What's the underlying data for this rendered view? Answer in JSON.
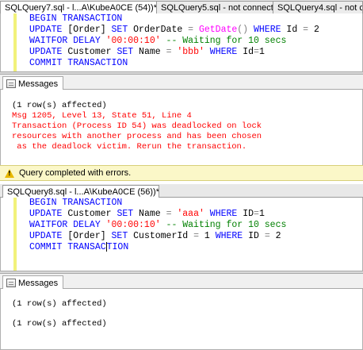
{
  "tabs_top": [
    {
      "label": "SQLQuery7.sql - l...A\\KubeA0CE (54))*",
      "active": true
    },
    {
      "label": "SQLQuery5.sql - not connected",
      "active": false
    },
    {
      "label": "SQLQuery4.sql - not conne",
      "active": false
    }
  ],
  "editor1": {
    "lines": [
      [
        {
          "t": "BEGIN TRANSACTION",
          "c": "kw"
        }
      ],
      [
        {
          "t": "UPDATE ",
          "c": "kw"
        },
        {
          "t": "[Order] ",
          "c": "plain"
        },
        {
          "t": "SET ",
          "c": "kw"
        },
        {
          "t": "OrderDate ",
          "c": "plain"
        },
        {
          "t": "= ",
          "c": "gr"
        },
        {
          "t": "GetDate",
          "c": "fn"
        },
        {
          "t": "() ",
          "c": "gr"
        },
        {
          "t": "WHERE ",
          "c": "kw"
        },
        {
          "t": "Id ",
          "c": "plain"
        },
        {
          "t": "= ",
          "c": "gr"
        },
        {
          "t": "2",
          "c": "plain"
        }
      ],
      [
        {
          "t": "WAITFOR DELAY ",
          "c": "kw"
        },
        {
          "t": "'00:00:10' ",
          "c": "str"
        },
        {
          "t": "-- Waiting for 10 secs",
          "c": "cm"
        }
      ],
      [
        {
          "t": "UPDATE ",
          "c": "kw"
        },
        {
          "t": "Customer ",
          "c": "plain"
        },
        {
          "t": "SET ",
          "c": "kw"
        },
        {
          "t": "Name ",
          "c": "plain"
        },
        {
          "t": "= ",
          "c": "gr"
        },
        {
          "t": "'bbb' ",
          "c": "str"
        },
        {
          "t": "WHERE ",
          "c": "kw"
        },
        {
          "t": "Id",
          "c": "plain"
        },
        {
          "t": "=",
          "c": "gr"
        },
        {
          "t": "1",
          "c": "plain"
        }
      ],
      [
        {
          "t": "COMMIT TRANSACTION",
          "c": "kw"
        }
      ]
    ]
  },
  "messages1": {
    "tab_label": "Messages",
    "lines": [
      {
        "text": "(1 row(s) affected)",
        "kind": "normal"
      },
      {
        "text": "Msg 1205, Level 13, State 51, Line 4",
        "kind": "error"
      },
      {
        "text": "Transaction (Process ID 54) was deadlocked on lock",
        "kind": "error"
      },
      {
        "text": "resources with another process and has been chosen",
        "kind": "error"
      },
      {
        "text": " as the deadlock victim. Rerun the transaction.",
        "kind": "error"
      }
    ]
  },
  "status1": {
    "text": "Query completed with errors."
  },
  "tab_second": {
    "label": "SQLQuery8.sql - l...A\\KubeA0CE (56))*"
  },
  "editor2": {
    "lines": [
      [
        {
          "t": "BEGIN TRANSACTION",
          "c": "kw"
        }
      ],
      [
        {
          "t": "UPDATE ",
          "c": "kw"
        },
        {
          "t": "Customer ",
          "c": "plain"
        },
        {
          "t": "SET ",
          "c": "kw"
        },
        {
          "t": "Name ",
          "c": "plain"
        },
        {
          "t": "= ",
          "c": "gr"
        },
        {
          "t": "'aaa' ",
          "c": "str"
        },
        {
          "t": "WHERE ",
          "c": "kw"
        },
        {
          "t": "ID",
          "c": "plain"
        },
        {
          "t": "=",
          "c": "gr"
        },
        {
          "t": "1",
          "c": "plain"
        }
      ],
      [
        {
          "t": "WAITFOR DELAY ",
          "c": "kw"
        },
        {
          "t": "'00:00:10' ",
          "c": "str"
        },
        {
          "t": "-- Waiting for 10 secs",
          "c": "cm"
        }
      ],
      [
        {
          "t": "UPDATE ",
          "c": "kw"
        },
        {
          "t": "[Order] ",
          "c": "plain"
        },
        {
          "t": "SET ",
          "c": "kw"
        },
        {
          "t": "CustomerId ",
          "c": "plain"
        },
        {
          "t": "= ",
          "c": "gr"
        },
        {
          "t": "1 ",
          "c": "plain"
        },
        {
          "t": "WHERE ",
          "c": "kw"
        },
        {
          "t": "ID ",
          "c": "plain"
        },
        {
          "t": "= ",
          "c": "gr"
        },
        {
          "t": "2",
          "c": "plain"
        }
      ],
      [
        {
          "t": "COMMIT TRANSAC",
          "c": "kw"
        },
        {
          "t": "|",
          "c": "cursor"
        },
        {
          "t": "TION",
          "c": "kw"
        }
      ]
    ]
  },
  "messages2": {
    "tab_label": "Messages",
    "lines": [
      {
        "text": "(1 row(s) affected)",
        "kind": "normal"
      },
      {
        "text": "(1 row(s) affected)",
        "kind": "normal"
      }
    ]
  },
  "colors": {
    "keyword": "#0000ff",
    "function": "#ff00ff",
    "string": "#ff0000",
    "comment": "#008000",
    "error_text": "#ff0000",
    "change_margin": "#f2f27a",
    "status_background": "#fbf7c8"
  },
  "icons": {
    "messages": "messages-icon",
    "status": "warning-icon"
  }
}
